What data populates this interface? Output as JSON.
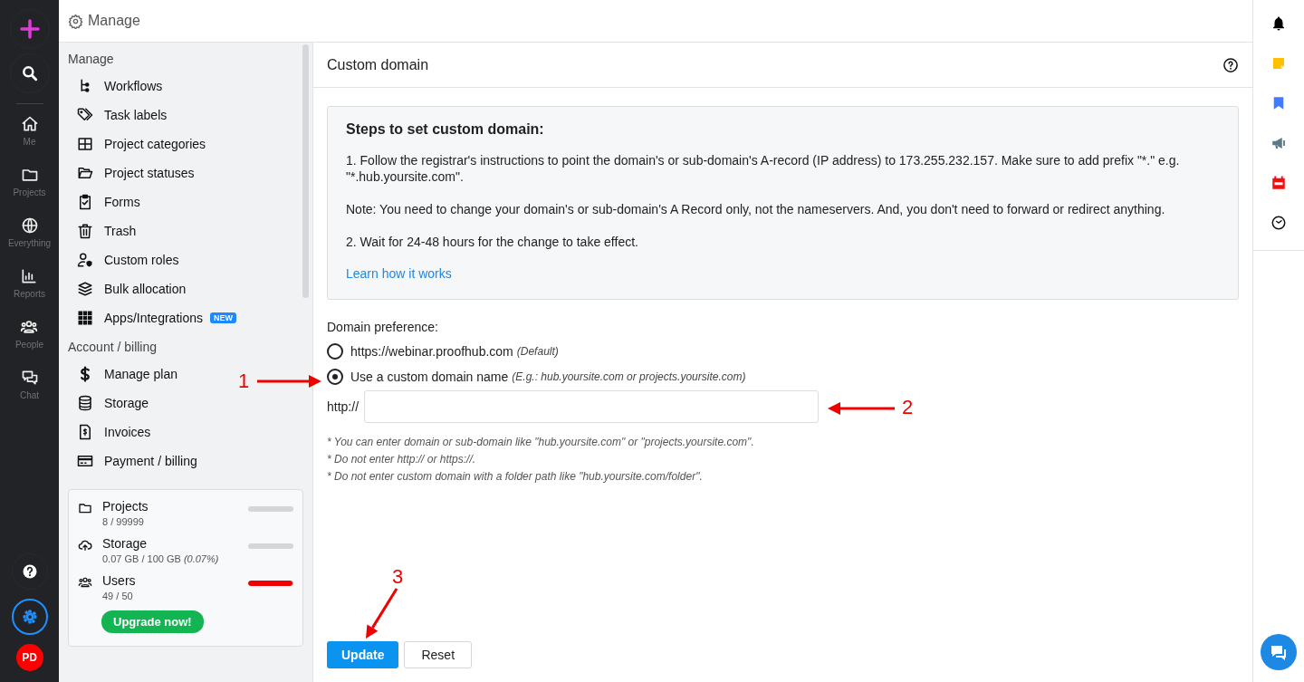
{
  "header": {
    "title": "Manage"
  },
  "rail": {
    "items": [
      {
        "label": "Me"
      },
      {
        "label": "Projects"
      },
      {
        "label": "Everything"
      },
      {
        "label": "Reports"
      },
      {
        "label": "People"
      },
      {
        "label": "Chat"
      }
    ],
    "settings_selected": true,
    "avatar": "PD"
  },
  "sidebar": {
    "sections": [
      {
        "title": "Manage",
        "items": [
          {
            "label": "Workflows"
          },
          {
            "label": "Task labels"
          },
          {
            "label": "Project categories"
          },
          {
            "label": "Project statuses"
          },
          {
            "label": "Forms"
          },
          {
            "label": "Trash"
          },
          {
            "label": "Custom roles"
          },
          {
            "label": "Bulk allocation"
          },
          {
            "label": "Apps/Integrations",
            "badge": "NEW"
          }
        ]
      },
      {
        "title": "Account / billing",
        "items": [
          {
            "label": "Manage plan"
          },
          {
            "label": "Storage"
          },
          {
            "label": "Invoices"
          },
          {
            "label": "Payment / billing"
          }
        ]
      }
    ],
    "usage": [
      {
        "name": "Projects",
        "reading": "8 / 99999",
        "level": 0
      },
      {
        "name": "Storage",
        "reading": "0.07 GB / 100 GB *(0.07%)*",
        "level": 0
      },
      {
        "name": "Users",
        "reading": "49 / 50",
        "level": 0.98
      }
    ],
    "upgrade_button": "Upgrade now!"
  },
  "main": {
    "title": "Custom domain",
    "steps": {
      "heading": "Steps to set custom domain:",
      "paragraphs": [
        "1. Follow the registrar's instructions to point the domain's or sub-domain's A-record (IP address) to 173.255.232.157. Make sure to add prefix \"*.\" e.g. \"*.hub.yoursite.com\".",
        "Note: You need to change your domain's or sub-domain's A Record only, not the nameservers. And, you don't need to forward or redirect anything.",
        "2. Wait for 24-48 hours for the change to take effect."
      ],
      "link": "Learn how it works"
    },
    "preference_label": "Domain preference:",
    "options": [
      {
        "label": "https://webinar.proofhub.com",
        "hint": "(Default)",
        "selected": false
      },
      {
        "label": "Use a custom domain name",
        "hint": "(E.g.: hub.yoursite.com or projects.yoursite.com)",
        "selected": true
      }
    ],
    "prefix": "http://",
    "notes": [
      "* You can enter domain or sub-domain like \"hub.yoursite.com\" or \"projects.yoursite.com\".",
      "* Do not enter http:// or https://.",
      "* Do not enter custom domain with a folder path like \"hub.yoursite.com/folder\"."
    ],
    "buttons": [
      {
        "label": "Update",
        "kind": "primary"
      },
      {
        "label": "Reset",
        "kind": "secondary"
      }
    ]
  },
  "annotations": [
    {
      "label": "1"
    },
    {
      "label": "2"
    },
    {
      "label": "3"
    }
  ]
}
